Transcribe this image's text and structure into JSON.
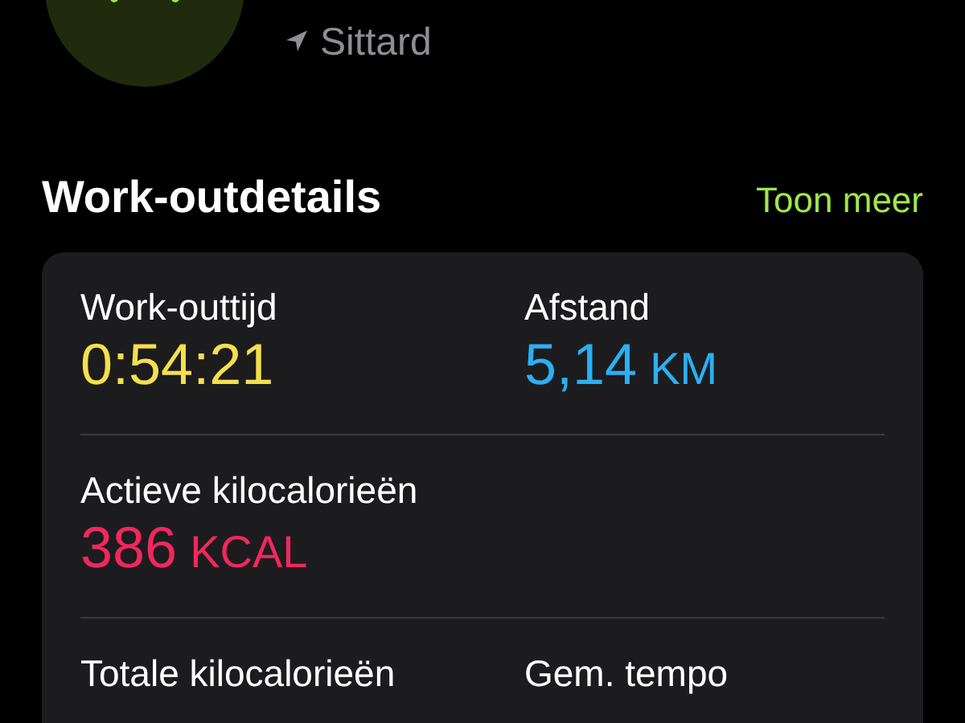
{
  "header": {
    "location": "Sittard"
  },
  "section": {
    "title": "Work-outdetails",
    "link": "Toon meer"
  },
  "rows": [
    {
      "cells": [
        {
          "label": "Work-outtijd",
          "value": "0:54:21",
          "color": "#f5df4d"
        },
        {
          "label": "Afstand",
          "value": "5,14",
          "unit": "KM",
          "color": "#2ab0f5"
        }
      ]
    },
    {
      "cells": [
        {
          "label": "Actieve kilocalorieën",
          "value": "386",
          "unit": "KCAL",
          "color": "#f2275d"
        }
      ]
    },
    {
      "cells": [
        {
          "label": "Totale kilocalorieën"
        },
        {
          "label": "Gem. tempo"
        }
      ]
    }
  ]
}
